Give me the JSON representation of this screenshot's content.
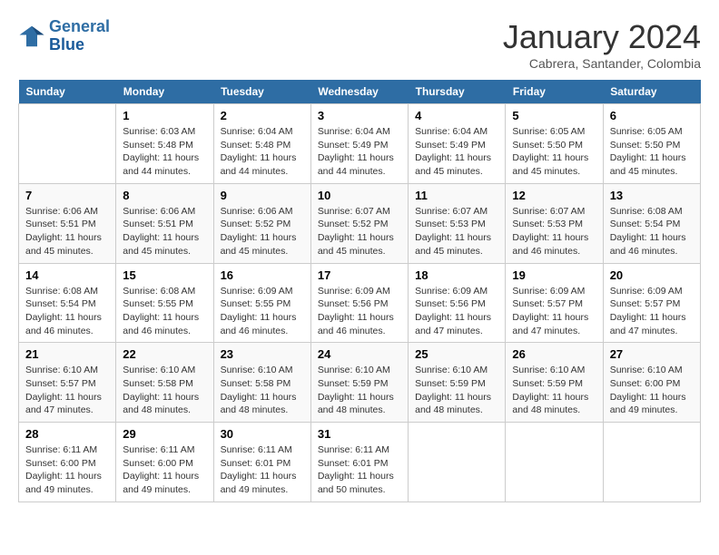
{
  "header": {
    "logo_line1": "General",
    "logo_line2": "Blue",
    "month_title": "January 2024",
    "subtitle": "Cabrera, Santander, Colombia"
  },
  "days_of_week": [
    "Sunday",
    "Monday",
    "Tuesday",
    "Wednesday",
    "Thursday",
    "Friday",
    "Saturday"
  ],
  "weeks": [
    [
      {
        "day": "",
        "info": ""
      },
      {
        "day": "1",
        "info": "Sunrise: 6:03 AM\nSunset: 5:48 PM\nDaylight: 11 hours\nand 44 minutes."
      },
      {
        "day": "2",
        "info": "Sunrise: 6:04 AM\nSunset: 5:48 PM\nDaylight: 11 hours\nand 44 minutes."
      },
      {
        "day": "3",
        "info": "Sunrise: 6:04 AM\nSunset: 5:49 PM\nDaylight: 11 hours\nand 44 minutes."
      },
      {
        "day": "4",
        "info": "Sunrise: 6:04 AM\nSunset: 5:49 PM\nDaylight: 11 hours\nand 45 minutes."
      },
      {
        "day": "5",
        "info": "Sunrise: 6:05 AM\nSunset: 5:50 PM\nDaylight: 11 hours\nand 45 minutes."
      },
      {
        "day": "6",
        "info": "Sunrise: 6:05 AM\nSunset: 5:50 PM\nDaylight: 11 hours\nand 45 minutes."
      }
    ],
    [
      {
        "day": "7",
        "info": "Sunrise: 6:06 AM\nSunset: 5:51 PM\nDaylight: 11 hours\nand 45 minutes."
      },
      {
        "day": "8",
        "info": "Sunrise: 6:06 AM\nSunset: 5:51 PM\nDaylight: 11 hours\nand 45 minutes."
      },
      {
        "day": "9",
        "info": "Sunrise: 6:06 AM\nSunset: 5:52 PM\nDaylight: 11 hours\nand 45 minutes."
      },
      {
        "day": "10",
        "info": "Sunrise: 6:07 AM\nSunset: 5:52 PM\nDaylight: 11 hours\nand 45 minutes."
      },
      {
        "day": "11",
        "info": "Sunrise: 6:07 AM\nSunset: 5:53 PM\nDaylight: 11 hours\nand 45 minutes."
      },
      {
        "day": "12",
        "info": "Sunrise: 6:07 AM\nSunset: 5:53 PM\nDaylight: 11 hours\nand 46 minutes."
      },
      {
        "day": "13",
        "info": "Sunrise: 6:08 AM\nSunset: 5:54 PM\nDaylight: 11 hours\nand 46 minutes."
      }
    ],
    [
      {
        "day": "14",
        "info": "Sunrise: 6:08 AM\nSunset: 5:54 PM\nDaylight: 11 hours\nand 46 minutes."
      },
      {
        "day": "15",
        "info": "Sunrise: 6:08 AM\nSunset: 5:55 PM\nDaylight: 11 hours\nand 46 minutes."
      },
      {
        "day": "16",
        "info": "Sunrise: 6:09 AM\nSunset: 5:55 PM\nDaylight: 11 hours\nand 46 minutes."
      },
      {
        "day": "17",
        "info": "Sunrise: 6:09 AM\nSunset: 5:56 PM\nDaylight: 11 hours\nand 46 minutes."
      },
      {
        "day": "18",
        "info": "Sunrise: 6:09 AM\nSunset: 5:56 PM\nDaylight: 11 hours\nand 47 minutes."
      },
      {
        "day": "19",
        "info": "Sunrise: 6:09 AM\nSunset: 5:57 PM\nDaylight: 11 hours\nand 47 minutes."
      },
      {
        "day": "20",
        "info": "Sunrise: 6:09 AM\nSunset: 5:57 PM\nDaylight: 11 hours\nand 47 minutes."
      }
    ],
    [
      {
        "day": "21",
        "info": "Sunrise: 6:10 AM\nSunset: 5:57 PM\nDaylight: 11 hours\nand 47 minutes."
      },
      {
        "day": "22",
        "info": "Sunrise: 6:10 AM\nSunset: 5:58 PM\nDaylight: 11 hours\nand 48 minutes."
      },
      {
        "day": "23",
        "info": "Sunrise: 6:10 AM\nSunset: 5:58 PM\nDaylight: 11 hours\nand 48 minutes."
      },
      {
        "day": "24",
        "info": "Sunrise: 6:10 AM\nSunset: 5:59 PM\nDaylight: 11 hours\nand 48 minutes."
      },
      {
        "day": "25",
        "info": "Sunrise: 6:10 AM\nSunset: 5:59 PM\nDaylight: 11 hours\nand 48 minutes."
      },
      {
        "day": "26",
        "info": "Sunrise: 6:10 AM\nSunset: 5:59 PM\nDaylight: 11 hours\nand 48 minutes."
      },
      {
        "day": "27",
        "info": "Sunrise: 6:10 AM\nSunset: 6:00 PM\nDaylight: 11 hours\nand 49 minutes."
      }
    ],
    [
      {
        "day": "28",
        "info": "Sunrise: 6:11 AM\nSunset: 6:00 PM\nDaylight: 11 hours\nand 49 minutes."
      },
      {
        "day": "29",
        "info": "Sunrise: 6:11 AM\nSunset: 6:00 PM\nDaylight: 11 hours\nand 49 minutes."
      },
      {
        "day": "30",
        "info": "Sunrise: 6:11 AM\nSunset: 6:01 PM\nDaylight: 11 hours\nand 49 minutes."
      },
      {
        "day": "31",
        "info": "Sunrise: 6:11 AM\nSunset: 6:01 PM\nDaylight: 11 hours\nand 50 minutes."
      },
      {
        "day": "",
        "info": ""
      },
      {
        "day": "",
        "info": ""
      },
      {
        "day": "",
        "info": ""
      }
    ]
  ]
}
